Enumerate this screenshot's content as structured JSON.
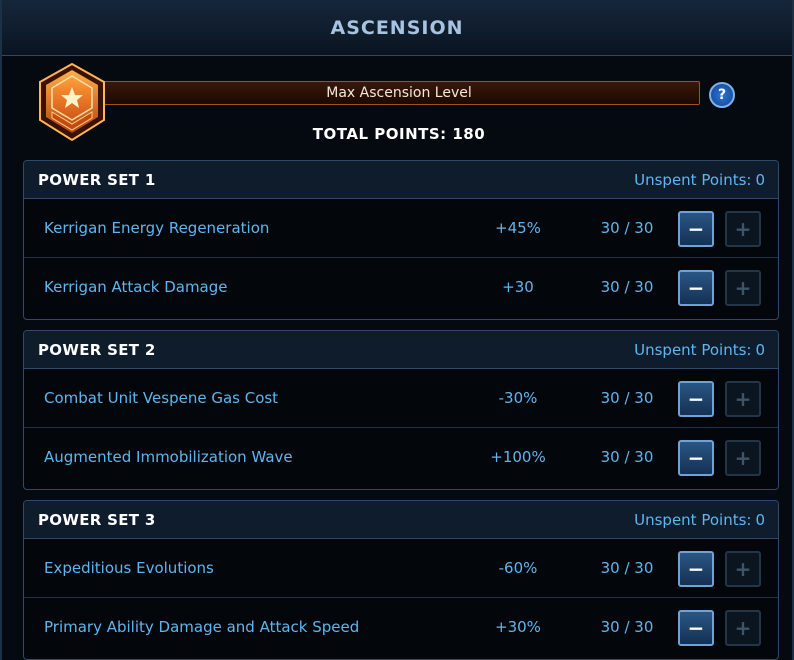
{
  "window": {
    "title": "ASCENSION"
  },
  "header": {
    "level_label": "Max Ascension Level",
    "help_glyph": "?",
    "total_points": "TOTAL POINTS: 180",
    "colors": {
      "accent": "#5fb6ef",
      "badge": "#e8892a",
      "level_bar_border": "#a5501c"
    }
  },
  "power_sets": [
    {
      "title": "POWER SET 1",
      "unspent_label": "Unspent Points:",
      "unspent_value": "0",
      "upgrades": [
        {
          "name": "Kerrigan Energy Regeneration",
          "bonus": "+45%",
          "points": "30 / 30"
        },
        {
          "name": "Kerrigan Attack Damage",
          "bonus": "+30",
          "points": "30 / 30"
        }
      ]
    },
    {
      "title": "POWER SET 2",
      "unspent_label": "Unspent Points:",
      "unspent_value": "0",
      "upgrades": [
        {
          "name": "Combat Unit Vespene Gas Cost",
          "bonus": "-30%",
          "points": "30 / 30"
        },
        {
          "name": "Augmented Immobilization Wave",
          "bonus": "+100%",
          "points": "30 / 30"
        }
      ]
    },
    {
      "title": "POWER SET 3",
      "unspent_label": "Unspent Points:",
      "unspent_value": "0",
      "upgrades": [
        {
          "name": "Expeditious Evolutions",
          "bonus": "-60%",
          "points": "30 / 30"
        },
        {
          "name": "Primary Ability Damage and Attack Speed",
          "bonus": "+30%",
          "points": "30 / 30"
        }
      ]
    }
  ],
  "controls": {
    "minus_glyph": "−",
    "plus_glyph": "+",
    "minus_icon": "minus-icon",
    "plus_icon": "plus-icon",
    "minus_enabled": true,
    "plus_enabled": false
  }
}
